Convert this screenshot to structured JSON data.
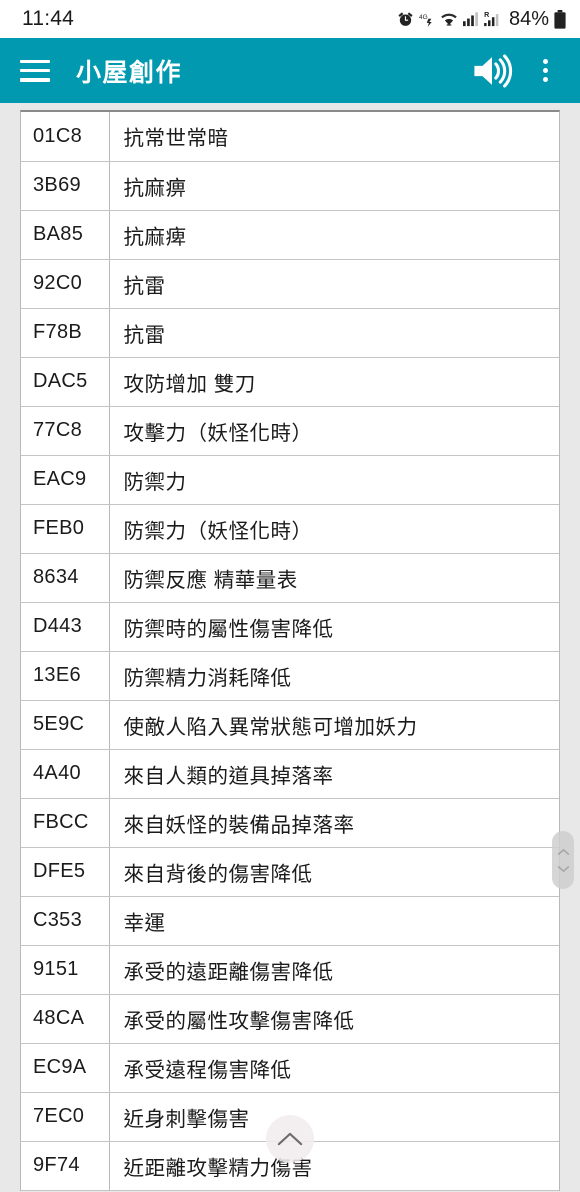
{
  "status_bar": {
    "clock": "11:44",
    "battery_percent": "84%",
    "icons": [
      "alarm-icon",
      "network-4g-icon",
      "wifi-icon",
      "signal-bars-icon",
      "signal-roaming-icon",
      "battery-icon"
    ]
  },
  "app_bar": {
    "menu_icon": "hamburger-menu-icon",
    "title": "小屋創作",
    "sound_icon": "sound-on-icon",
    "overflow_icon": "overflow-menu-icon",
    "background_color": "#0099b0"
  },
  "table": {
    "columns": [
      "code",
      "name"
    ],
    "rows": [
      {
        "code": "01C8",
        "name": "抗常世常暗"
      },
      {
        "code": "3B69",
        "name": "抗麻痹"
      },
      {
        "code": "BA85",
        "name": "抗麻痺"
      },
      {
        "code": "92C0",
        "name": "抗雷"
      },
      {
        "code": "F78B",
        "name": "抗雷"
      },
      {
        "code": "DAC5",
        "name": "攻防增加 雙刀"
      },
      {
        "code": "77C8",
        "name": "攻擊力（妖怪化時）"
      },
      {
        "code": "EAC9",
        "name": "防禦力"
      },
      {
        "code": "FEB0",
        "name": "防禦力（妖怪化時）"
      },
      {
        "code": "8634",
        "name": "防禦反應 精華量表"
      },
      {
        "code": "D443",
        "name": "防禦時的屬性傷害降低"
      },
      {
        "code": "13E6",
        "name": "防禦精力消耗降低"
      },
      {
        "code": "5E9C",
        "name": "使敵人陷入異常狀態可增加妖力"
      },
      {
        "code": "4A40",
        "name": "來自人類的道具掉落率"
      },
      {
        "code": "FBCC",
        "name": "來自妖怪的裝備品掉落率"
      },
      {
        "code": "DFE5",
        "name": "來自背後的傷害降低"
      },
      {
        "code": "C353",
        "name": "幸運"
      },
      {
        "code": "9151",
        "name": "承受的遠距離傷害降低"
      },
      {
        "code": "48CA",
        "name": "承受的屬性攻擊傷害降低"
      },
      {
        "code": "EC9A",
        "name": "承受遠程傷害降低"
      },
      {
        "code": "7EC0",
        "name": "近身刺擊傷害"
      },
      {
        "code": "9F74",
        "name": "近距離攻擊精力傷害"
      }
    ]
  },
  "scroll_handle": {
    "icon": "scroll-drag-handle-icon"
  },
  "fab": {
    "icon": "chevron-up-icon"
  }
}
